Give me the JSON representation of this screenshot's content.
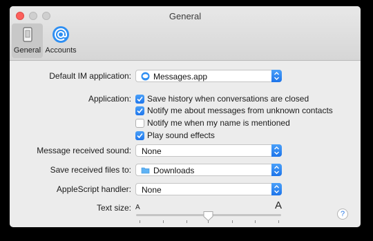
{
  "window": {
    "title": "General"
  },
  "toolbar": {
    "items": [
      {
        "label": "General",
        "icon": "phone-switch-icon",
        "selected": true
      },
      {
        "label": "Accounts",
        "icon": "at-sign-icon",
        "selected": false
      }
    ]
  },
  "settings": {
    "default_im": {
      "label": "Default IM application:",
      "value": "Messages.app",
      "icon": "messages-app-icon"
    },
    "application": {
      "label": "Application:",
      "options": [
        {
          "label": "Save history when conversations are closed",
          "checked": true
        },
        {
          "label": "Notify me about messages from unknown contacts",
          "checked": true
        },
        {
          "label": "Notify me when my name is mentioned",
          "checked": false
        },
        {
          "label": "Play sound effects",
          "checked": true
        }
      ]
    },
    "message_sound": {
      "label": "Message received sound:",
      "value": "None"
    },
    "save_files": {
      "label": "Save received files to:",
      "value": "Downloads",
      "icon": "folder-icon"
    },
    "applescript": {
      "label": "AppleScript handler:",
      "value": "None"
    },
    "text_size": {
      "label": "Text size:",
      "min_label": "A",
      "max_label": "A",
      "level": 0.5,
      "ticks": 7
    }
  },
  "help": {
    "label": "?"
  },
  "colors": {
    "accent": "#1d74ea",
    "close_button": "#fc605c"
  }
}
